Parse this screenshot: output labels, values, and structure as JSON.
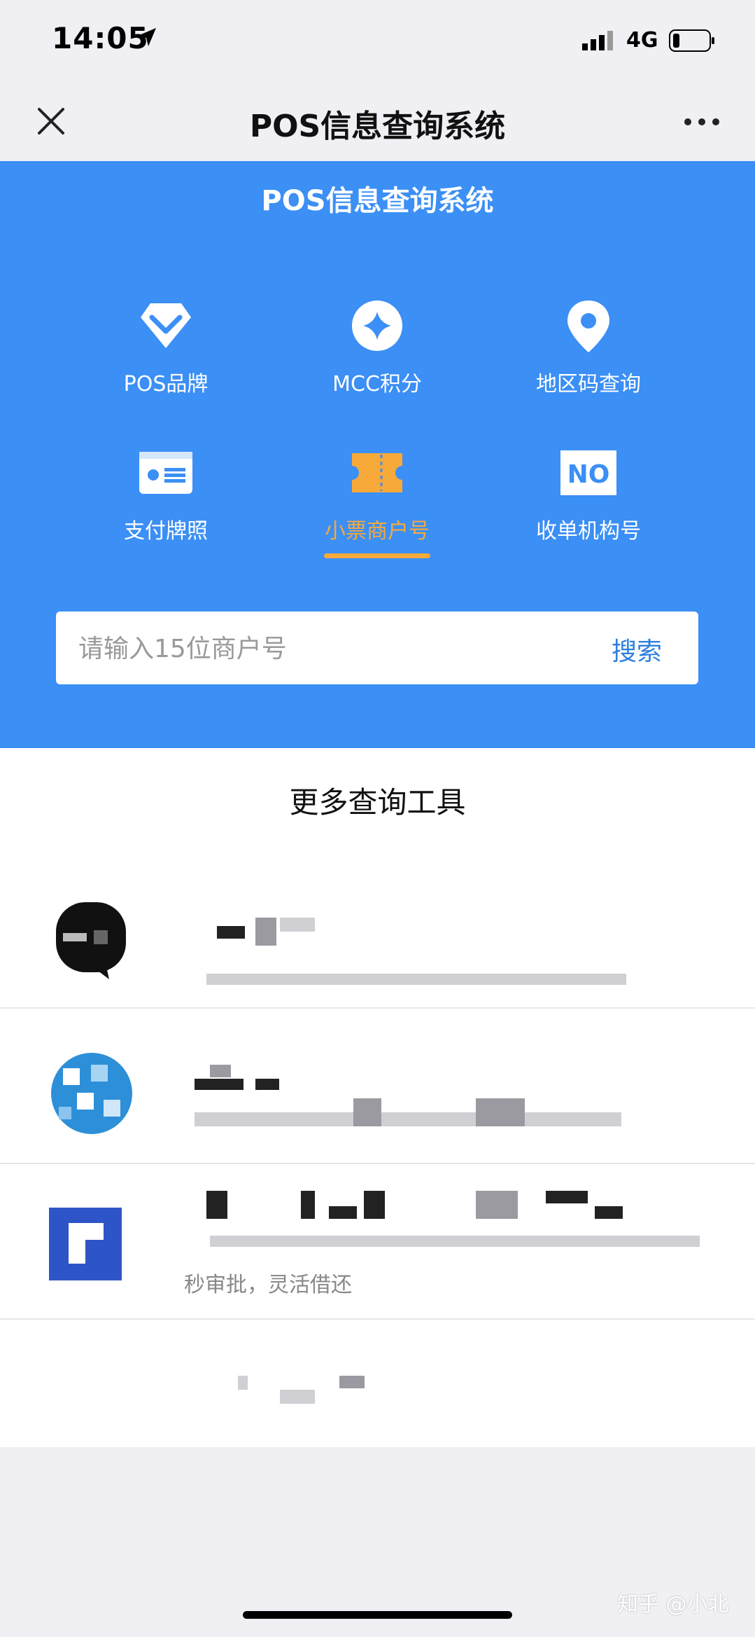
{
  "status_bar": {
    "time": "14:05",
    "network": "4G"
  },
  "nav": {
    "title": "POS信息查询系统"
  },
  "hero": {
    "title": "POS信息查询系统",
    "tools": [
      {
        "label": "POS品牌",
        "icon": "diamond-icon"
      },
      {
        "label": "MCC积分",
        "icon": "mcc-icon"
      },
      {
        "label": "地区码查询",
        "icon": "location-pin-icon"
      },
      {
        "label": "支付牌照",
        "icon": "license-card-icon"
      },
      {
        "label": "小票商户号",
        "icon": "ticket-icon",
        "active": true
      },
      {
        "label": "收单机构号",
        "icon": "no-badge-icon",
        "badge_text": "NO"
      }
    ]
  },
  "search": {
    "placeholder": "请输入15位商户号",
    "button": "搜索"
  },
  "more_tools": {
    "title": "更多查询工具",
    "items": [
      {
        "subtitle": ""
      },
      {
        "subtitle": ""
      },
      {
        "subtitle": "秒审批，灵活借还"
      },
      {
        "subtitle": ""
      }
    ]
  },
  "watermark": "知乎 @小北",
  "colors": {
    "brand_blue": "#3b8ff5",
    "accent_orange": "#f7a93a",
    "search_blue": "#2d7fe0"
  }
}
